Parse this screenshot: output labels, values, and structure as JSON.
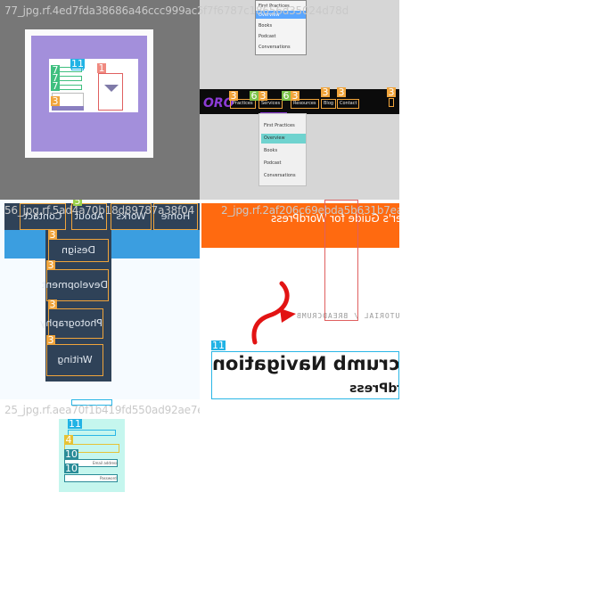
{
  "tiles": {
    "t1": {
      "filename": "77_jpg.rf.4ed7fda38686a46ccc999ac2"
    },
    "t2": {
      "filename": "3de26f7f6787c18656d35024d78d",
      "top_dropdown": [
        "First Practices",
        "Overview",
        "Books",
        "Podcast",
        "Conversations"
      ],
      "nav": [
        "Practices",
        "Services",
        "Resources",
        "Blog",
        "Contact"
      ],
      "dropdown": [
        "First Practices",
        "Overview",
        "Books",
        "Podcast",
        "Conversations"
      ]
    },
    "t3": {
      "filename": "56_jpg.rf.5ad4a70b18d89787a38f04",
      "tabs": [
        "Home",
        "Works",
        "About",
        "Contact"
      ],
      "dropdown": [
        "Design",
        "Development",
        "Photography",
        "Writing"
      ]
    },
    "t4": {
      "filename": "2_jpg.rf.2af206c69ebda5b631b7ea80bf230e",
      "header": "Beginner's Guide for WordPress",
      "breadcrumb": "HOME / TUTORIAL / BREADCRUMB",
      "title": "How to Display Breadcrumb Navigation",
      "title_line2": "in WordPress"
    },
    "t5": {
      "filename": "25_jpg.rf.aea70f1b419fd550ad92ae7e2a13e3",
      "fields": [
        "Email address",
        "Password"
      ]
    }
  },
  "annotation_tags": {
    "t1": [
      "11",
      "1",
      "7",
      "7",
      "7",
      "3"
    ],
    "t2": [
      "3",
      "3",
      "6",
      "3",
      "6",
      "3",
      "3",
      "3",
      "3"
    ],
    "t3": [
      "3",
      "3",
      "5",
      "3",
      "3",
      "3",
      "3",
      "3",
      "3"
    ],
    "t4": [
      "11",
      "11"
    ],
    "t5": [
      "11",
      "11",
      "4",
      "10",
      "10"
    ]
  },
  "colors": {
    "label_3": "#f0a43b",
    "label_11": "#22b3e5",
    "label_1": "#f08a80",
    "label_6": "#7cc24a",
    "label_7": "#3fbf7f",
    "label_4": "#e6c235",
    "label_10": "#2a8c98"
  }
}
